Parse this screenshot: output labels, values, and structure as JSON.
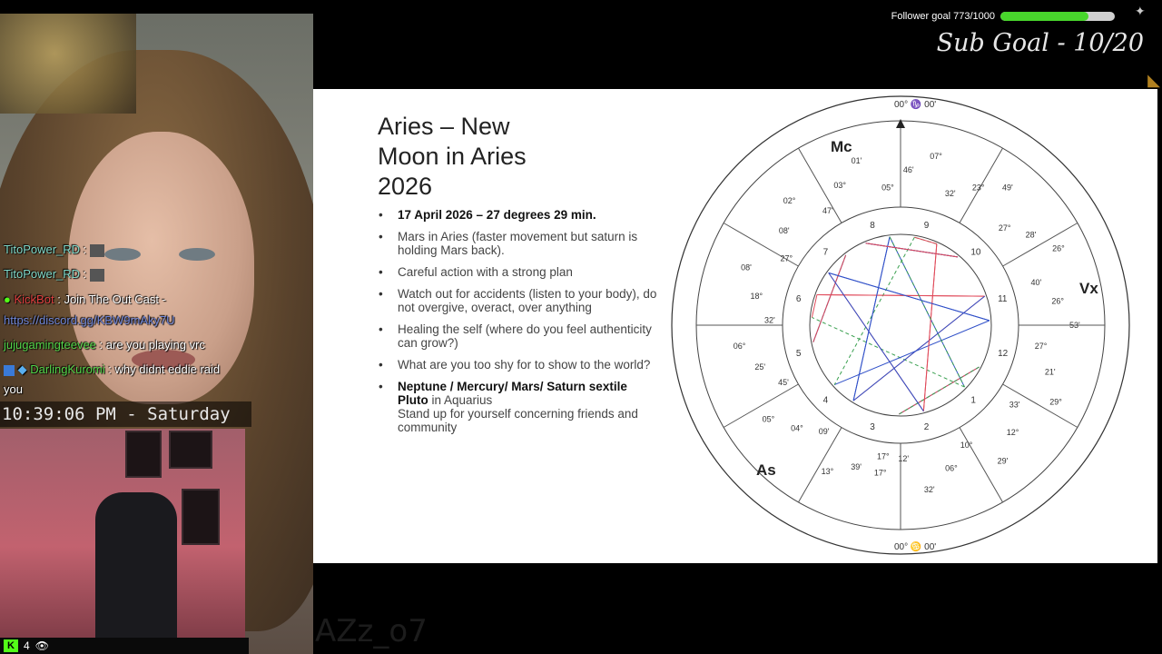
{
  "stream_overlay": {
    "follower_goal_label": "Follower goal 773/1000",
    "follower_progress": 0.773,
    "sub_goal": "Sub Goal - 10/20",
    "clock": "10:39:06 PM - Saturday",
    "viewer_count": "4",
    "watermark": "AZz_o7"
  },
  "chat": [
    {
      "user": "TitoPower_RD",
      "sep": ":",
      "message": ""
    },
    {
      "user": "TitoPower_RD",
      "sep": ":",
      "message": ""
    },
    {
      "user": "KickBot",
      "sep": ":",
      "message": "Join The Out Cast -"
    },
    {
      "user": "",
      "sep": "",
      "message": "https://discord.gg/KBW9mAky7U"
    },
    {
      "user": "jujugamingteevee",
      "sep": ":",
      "message": "are you playing vrc"
    },
    {
      "user": "DarlingKuromi",
      "sep": ":",
      "message": "why didnt eddie raid"
    },
    {
      "user": "",
      "sep": "",
      "message": "you"
    }
  ],
  "slide": {
    "title_lines": [
      "Aries – New",
      "Moon in Aries",
      "2026"
    ],
    "bullets": [
      {
        "bold": "17 April 2026 – 27 degrees 29 min.",
        "text": ""
      },
      {
        "bold": "",
        "text": "Mars in Aries (faster movement but saturn is holding Mars back)."
      },
      {
        "bold": "",
        "text": "Careful action with a strong plan"
      },
      {
        "bold": "",
        "text": "Watch out for accidents (listen to your body), do not overgive, overact, over anything"
      },
      {
        "bold": "",
        "text": "Healing the self (where do you feel authenticity can grow?)"
      },
      {
        "bold": "",
        "text": "What are you too shy for to show to the world?"
      },
      {
        "bold": "Neptune / Mercury/ Mars/ Saturn sextile Pluto",
        "text": " in Aquarius",
        "extra": "Stand up for yourself concerning friends and community"
      }
    ]
  },
  "chart_wheel": {
    "house_numbers": [
      "1",
      "2",
      "3",
      "4",
      "5",
      "6",
      "7",
      "8",
      "9",
      "10",
      "11",
      "12"
    ],
    "cusp_labels": [
      "00° ♑ 00'",
      "00° ♋ 00'",
      "Mc",
      "Vx",
      "As"
    ],
    "degree_labels": [
      "17°",
      "39'",
      "13°",
      "09'",
      "04°",
      "05°",
      "45'",
      "25'",
      "06°",
      "32'",
      "18°",
      "08'",
      "27°",
      "08'",
      "02°",
      "47'",
      "03°",
      "01'",
      "05°",
      "46'",
      "07°",
      "32'",
      "23°",
      "49'",
      "27°",
      "28'",
      "26°",
      "40'",
      "26°",
      "53'",
      "27°",
      "21'",
      "29°",
      "33'",
      "12°",
      "29'",
      "10°",
      "06°",
      "32'",
      "12'",
      "17°"
    ]
  }
}
